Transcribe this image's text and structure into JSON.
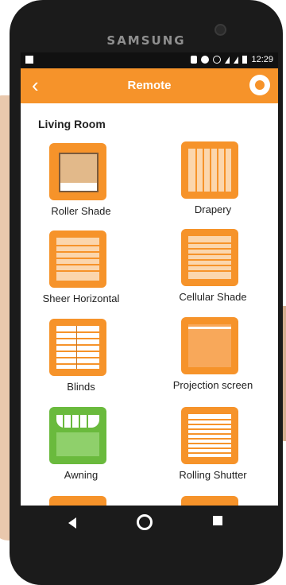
{
  "device": {
    "brand": "SAMSUNG"
  },
  "status_bar": {
    "time": "12:29"
  },
  "header": {
    "title": "Remote",
    "back_icon": "chevron-left-icon",
    "menu_icon": "circle-icon",
    "accent": "#f6932a"
  },
  "room": {
    "title": "Living Room"
  },
  "devices": [
    {
      "label": "Roller Shade",
      "icon": "roller-shade-icon",
      "color": "#f6932a"
    },
    {
      "label": "Drapery",
      "icon": "drapery-icon",
      "color": "#f6932a"
    },
    {
      "label": "Sheer Horizontal",
      "icon": "sheer-horizontal-icon",
      "color": "#f6932a"
    },
    {
      "label": "Cellular Shade",
      "icon": "cellular-shade-icon",
      "color": "#f6932a"
    },
    {
      "label": "Blinds",
      "icon": "blinds-icon",
      "color": "#f6932a"
    },
    {
      "label": "Projection screen",
      "icon": "projection-screen-icon",
      "color": "#f6932a"
    },
    {
      "label": "Awning",
      "icon": "awning-icon",
      "color": "#6aba3d"
    },
    {
      "label": "Rolling Shutter",
      "icon": "rolling-shutter-icon",
      "color": "#f6932a"
    }
  ],
  "navigation": {
    "back": "back-icon",
    "home": "home-icon",
    "recents": "recents-icon"
  }
}
